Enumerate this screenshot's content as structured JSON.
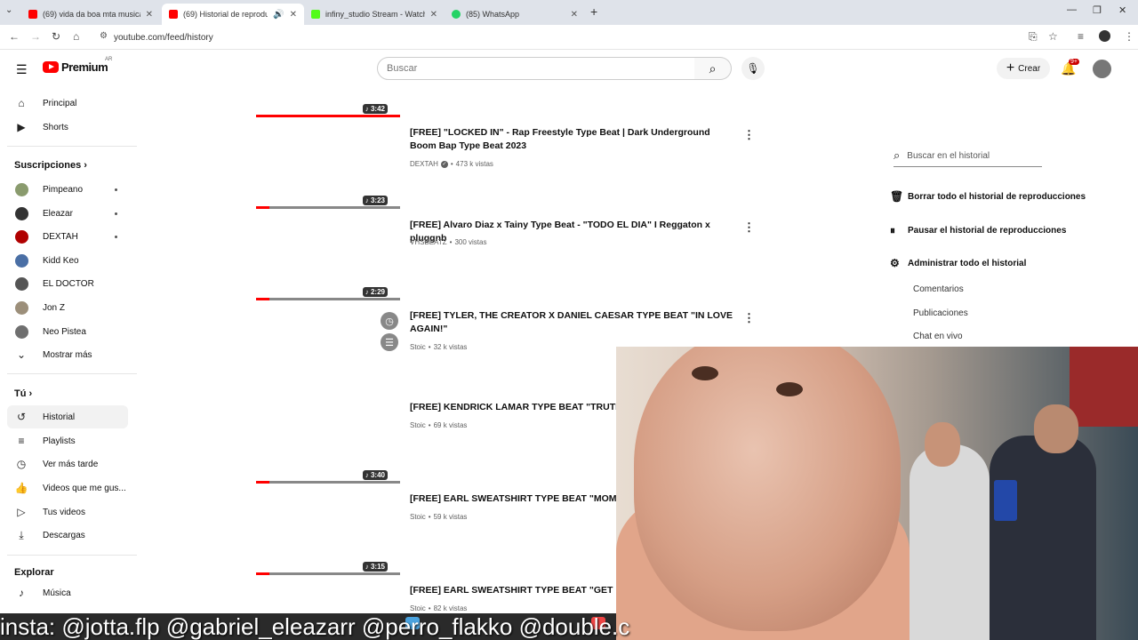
{
  "browser": {
    "tabs": [
      {
        "title": "(69) vida da boa mta musica - Y",
        "favicon": "youtube-icon",
        "active": false
      },
      {
        "title": "(69) Historial de reproducción",
        "favicon": "youtube-icon",
        "active": true
      },
      {
        "title": "infiny_studio Stream - Watch Li",
        "favicon": "kick-icon",
        "active": false
      },
      {
        "title": "(85) WhatsApp",
        "favicon": "whatsapp-icon",
        "active": false
      }
    ],
    "url": "youtube.com/feed/history"
  },
  "header": {
    "logo_text": "Premium",
    "logo_region": "AR",
    "search_placeholder": "Buscar",
    "create_label": "Crear",
    "notification_count": "9+"
  },
  "sidebar": {
    "main": [
      {
        "label": "Principal",
        "icon": "home-icon"
      },
      {
        "label": "Shorts",
        "icon": "shorts-icon"
      }
    ],
    "subs_heading": "Suscripciones",
    "subscriptions": [
      {
        "label": "Pimpeano",
        "color": "#8a9b6e",
        "dot": true
      },
      {
        "label": "Eleazar",
        "color": "#333333",
        "dot": true
      },
      {
        "label": "DEXTAH",
        "color": "#b00000",
        "dot": true
      },
      {
        "label": "Kidd Keo",
        "color": "#4a6fa5",
        "dot": false
      },
      {
        "label": "EL DOCTOR",
        "color": "#555555",
        "dot": false
      },
      {
        "label": "Jon Z",
        "color": "#9c8f7a",
        "dot": false
      },
      {
        "label": "Neo Pistea",
        "color": "#6f6f6f",
        "dot": false
      }
    ],
    "show_more": "Mostrar más",
    "you_heading": "Tú",
    "you": [
      {
        "label": "Historial",
        "icon": "history-icon"
      },
      {
        "label": "Playlists",
        "icon": "playlists-icon"
      },
      {
        "label": "Ver más tarde",
        "icon": "watch-later-icon"
      },
      {
        "label": "Videos que me gus...",
        "icon": "thumbs-up-icon"
      },
      {
        "label": "Tus videos",
        "icon": "your-videos-icon"
      },
      {
        "label": "Descargas",
        "icon": "download-icon"
      }
    ],
    "explore_heading": "Explorar",
    "explore": [
      {
        "label": "Música",
        "icon": "music-icon"
      }
    ]
  },
  "videos": [
    {
      "duration": "3:42",
      "progress": 1.0,
      "title": "",
      "channel": "",
      "views": ""
    },
    {
      "duration": "3:23",
      "progress": 0.09,
      "title": "[FREE] \"LOCKED IN\" - Rap Freestyle Type Beat | Dark Underground Boom Bap Type Beat 2023",
      "channel": "DEXTAH",
      "verified": true,
      "views": "473 k vistas"
    },
    {
      "duration": "2:29",
      "progress": 0.09,
      "title": "[FREE] Alvaro Diaz x Tainy Type Beat - \"TODO EL DIA\" I Reggaton x pluggnb",
      "channel": "VHSBEATZ",
      "views": "300 vistas"
    },
    {
      "duration": "",
      "progress": 0,
      "title": "[FREE] TYLER, THE CREATOR X DANIEL CAESAR TYPE BEAT \"IN LOVE AGAIN!\"",
      "channel": "Stoic",
      "views": "32 k vistas"
    },
    {
      "duration": "3:40",
      "progress": 0.09,
      "title": "[FREE] KENDRICK LAMAR TYPE BEAT \"TRUTH BE",
      "channel": "Stoic",
      "views": "69 k vistas"
    },
    {
      "duration": "3:15",
      "progress": 0.09,
      "title": "[FREE] EARL SWEATSHIRT TYPE BEAT \"MOMMA",
      "channel": "Stoic",
      "views": "59 k vistas"
    },
    {
      "duration": "",
      "progress": 0,
      "title": "[FREE] EARL SWEATSHIRT TYPE BEAT \"GET HIGH",
      "channel": "Stoic",
      "views": "82 k vistas"
    }
  ],
  "history_panel": {
    "search_placeholder": "Buscar en el historial",
    "actions": [
      {
        "label": "Borrar todo el historial de reproducciones",
        "icon": "trash-icon"
      },
      {
        "label": "Pausar el historial de reproducciones",
        "icon": "pause-icon"
      },
      {
        "label": "Administrar todo el historial",
        "icon": "gear-icon"
      }
    ],
    "sub_links": [
      "Comentarios",
      "Publicaciones",
      "Chat en vivo"
    ]
  },
  "overlay_caption": "insta: @jotta.flp @gabriel_eleazarr @perro_flakko @double.c"
}
